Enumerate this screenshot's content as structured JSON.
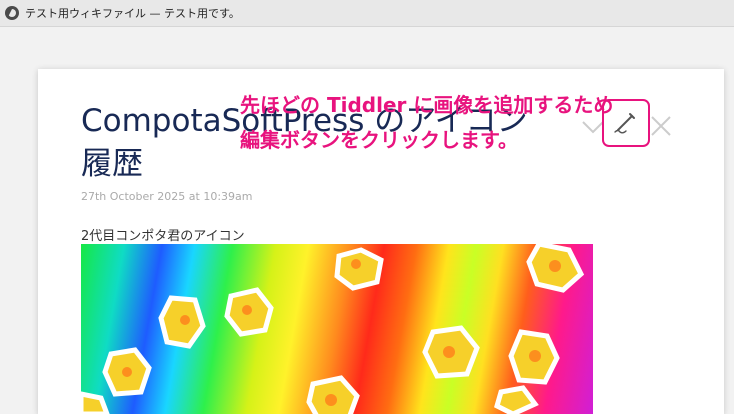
{
  "window": {
    "title": "テスト用ウィキファイル — テスト用です。",
    "icon": "globe-icon"
  },
  "tiddler": {
    "title": "CompotaSoftPress のアイコン履歴",
    "date": "27th October 2025 at 10:39am",
    "caption": "2代目コンポタ君のアイコン",
    "toolbar": {
      "more_icon": "chevron-down-icon",
      "edit_icon": "pencil-icon",
      "close_icon": "close-icon"
    },
    "image": {
      "description_icon": "corn-kernel-pattern"
    }
  },
  "annotation": {
    "line1": "先ほどの Tiddler に画像を追加するため",
    "line2": "編集ボタンをクリックします。",
    "color": "#e8137e"
  },
  "colors": {
    "title": "#182955",
    "highlight": "#e8137e",
    "date": "#aaaaaa"
  }
}
